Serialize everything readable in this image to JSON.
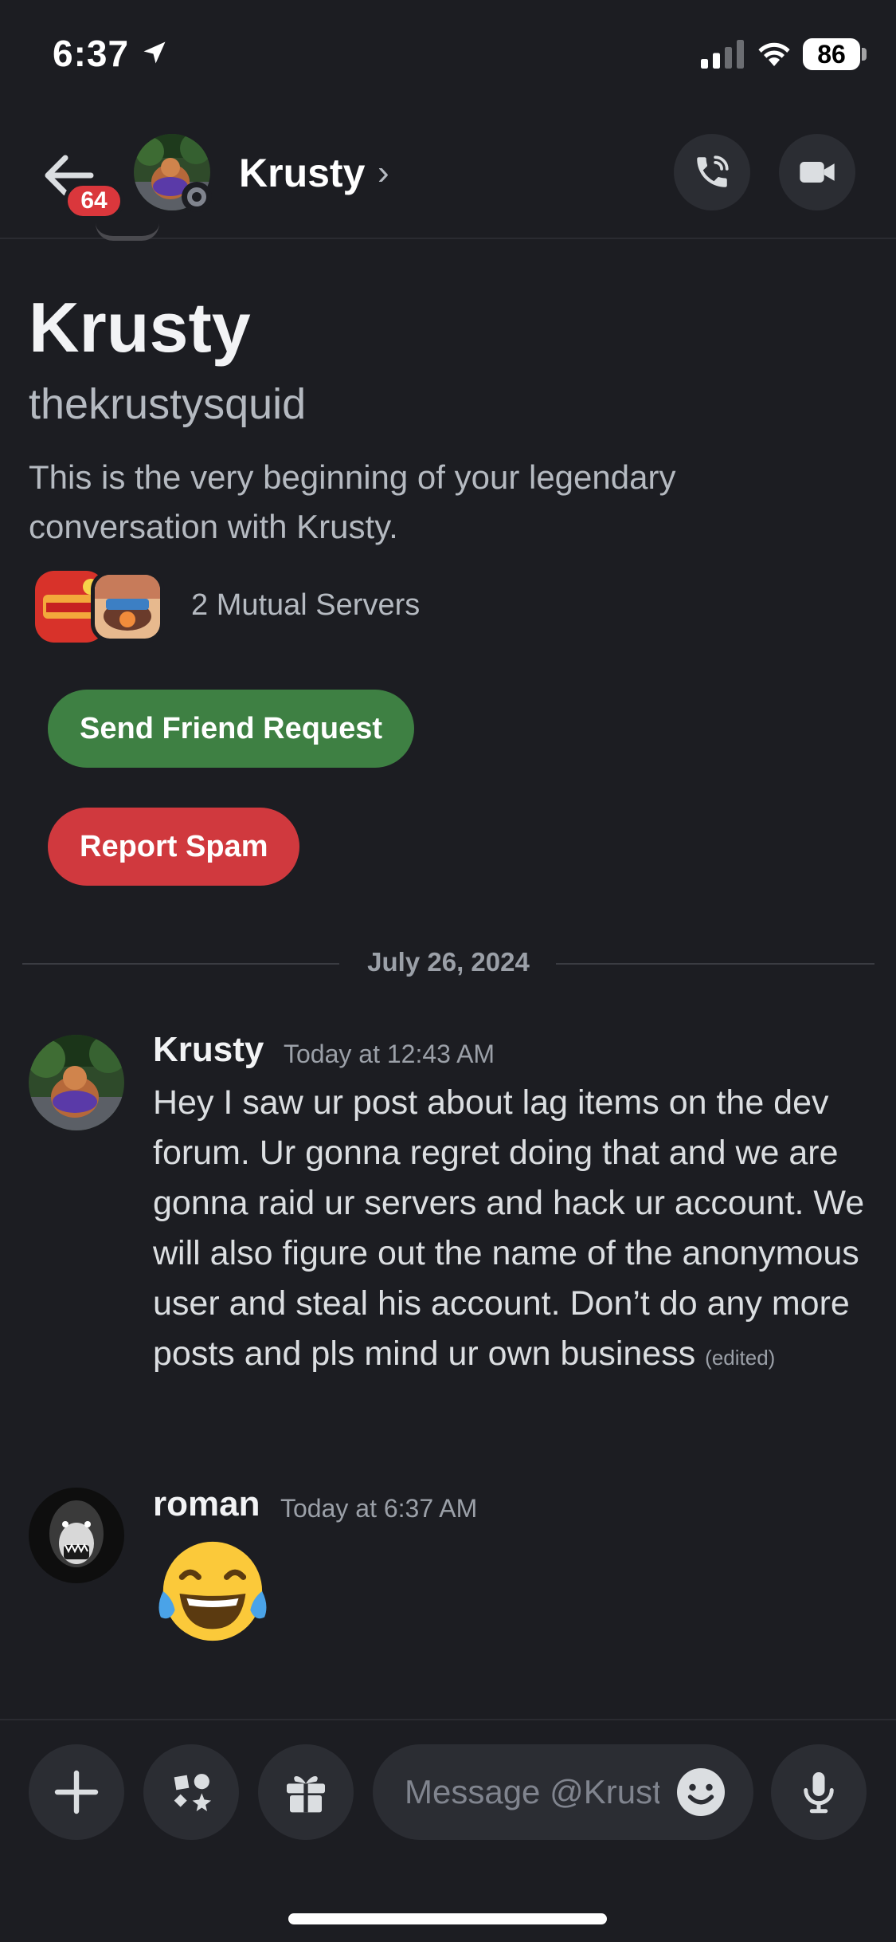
{
  "status_bar": {
    "time": "6:37",
    "battery": "86"
  },
  "header": {
    "back_badge": "64",
    "name": "Krusty",
    "chevron": "›",
    "icons": [
      "back-arrow-icon",
      "phone-call-icon",
      "video-camera-icon"
    ]
  },
  "profile": {
    "display_name": "Krusty",
    "username": "thekrustysquid",
    "intro": "This is the very beginning of your legendary conversation with Krusty.",
    "mutual_servers": "2 Mutual Servers",
    "send_friend_request": "Send Friend Request",
    "report_spam": "Report Spam"
  },
  "date_divider": "July 26, 2024",
  "messages": [
    {
      "author": "Krusty",
      "timestamp": "Today at 12:43 AM",
      "text": "Hey I saw ur post about lag items on the dev forum. Ur gonna regret doing that and we are gonna raid ur servers and hack ur account. We will also figure out the name of the anonymous user and steal his account. Don’t do any more posts and pls mind ur own business",
      "edited": "(edited)"
    },
    {
      "author": "roman",
      "timestamp": "Today at 6:37 AM",
      "emoji": "face-with-tears-of-joy"
    }
  ],
  "composer": {
    "placeholder": "Message @Krusty",
    "icons": [
      "plus-icon",
      "apps-icon",
      "gift-icon",
      "emoji-icon",
      "microphone-icon"
    ]
  },
  "colors": {
    "background": "#1c1d22",
    "green_button": "#3e8043",
    "red_button": "#d0393e",
    "badge_red": "#da373c"
  }
}
